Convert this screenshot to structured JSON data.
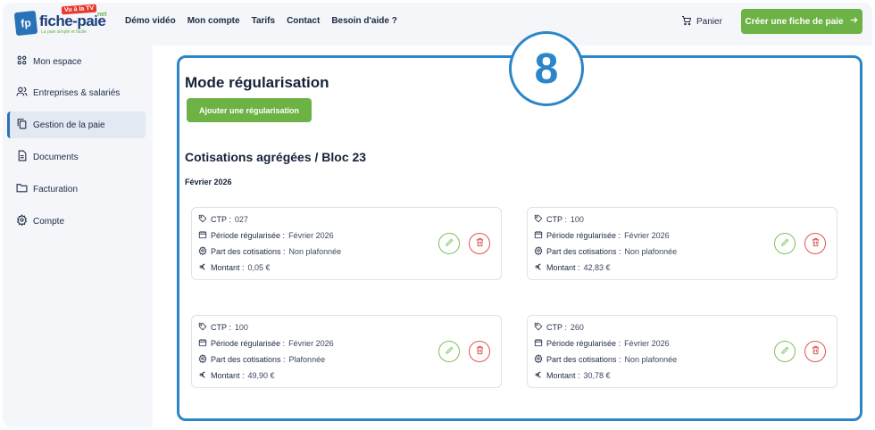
{
  "header": {
    "logo": {
      "mark": "fp",
      "name": "fiche-paie",
      "net": ".net",
      "tv": "Vu à la TV",
      "tagline": "La paie simple et facile"
    },
    "nav": [
      "Démo vidéo",
      "Mon compte",
      "Tarifs",
      "Contact",
      "Besoin d'aide ?"
    ],
    "cart_label": "Panier",
    "cta_label": "Créer une fiche de paie"
  },
  "sidebar": {
    "items": [
      {
        "label": "Mon espace",
        "icon": "grid-icon"
      },
      {
        "label": "Entreprises & salariés",
        "icon": "users-icon"
      },
      {
        "label": "Gestion de la paie",
        "icon": "copy-icon",
        "active": true
      },
      {
        "label": "Documents",
        "icon": "document-icon"
      },
      {
        "label": "Facturation",
        "icon": "folder-icon"
      },
      {
        "label": "Compte",
        "icon": "gear-icon"
      }
    ]
  },
  "main": {
    "step_badge": "8",
    "title": "Mode régularisation",
    "add_button": "Ajouter une régularisation",
    "subtitle": "Cotisations agrégées / Bloc 23",
    "month": "Février 2026",
    "labels": {
      "ctp": "CTP :",
      "periode": "Période régularisée :",
      "part": "Part des cotisations :",
      "montant": "Montant :"
    },
    "cards": [
      {
        "ctp": "027",
        "periode": "Février 2026",
        "part": "Non plafonnée",
        "montant": "0,05 €"
      },
      {
        "ctp": "100",
        "periode": "Février 2026",
        "part": "Non plafonnée",
        "montant": "42,83 €"
      },
      {
        "ctp": "100",
        "periode": "Février 2026",
        "part": "Plafonnée",
        "montant": "49,90 €"
      },
      {
        "ctp": "260",
        "periode": "Février 2026",
        "part": "Non plafonnée",
        "montant": "30,78 €"
      }
    ]
  },
  "colors": {
    "accent_blue": "#2a86c8",
    "green": "#6db245",
    "red": "#e05252",
    "text": "#16223a"
  }
}
